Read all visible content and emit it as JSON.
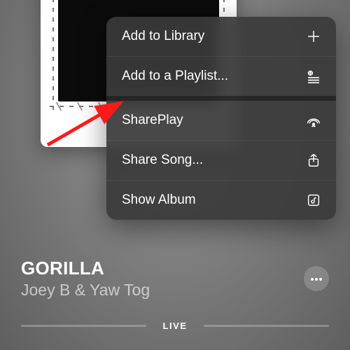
{
  "track": {
    "title": "GORILLA",
    "artist": "Joey B & Yaw Tog",
    "live_label": "LIVE"
  },
  "menu": {
    "add_library": "Add to Library",
    "add_playlist": "Add to a Playlist...",
    "shareplay": "SharePlay",
    "share_song": "Share Song...",
    "show_album": "Show Album"
  },
  "icons": {
    "plus": "plus-icon",
    "playlist_add": "playlist-add-icon",
    "shareplay": "shareplay-icon",
    "share": "share-icon",
    "album": "album-icon",
    "more": "ellipsis-icon"
  },
  "annotation": {
    "arrow_target": "shareplay-menu-item"
  }
}
